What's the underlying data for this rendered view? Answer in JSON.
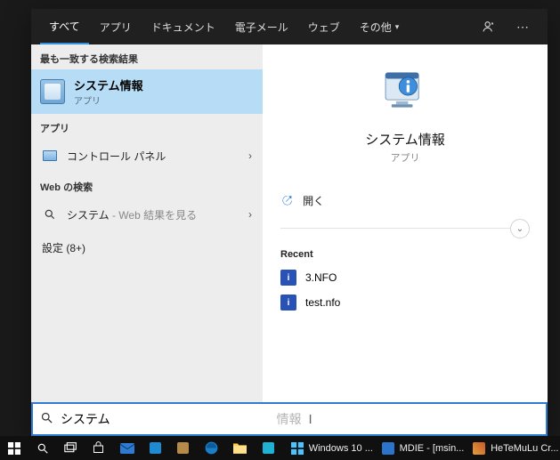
{
  "tabs": {
    "all": "すべて",
    "apps": "アプリ",
    "documents": "ドキュメント",
    "email": "電子メール",
    "web": "ウェブ",
    "more": "その他"
  },
  "left": {
    "best_header": "最も一致する検索結果",
    "best_title": "システム情報",
    "best_sub": "アプリ",
    "apps_header": "アプリ",
    "control_panel": "コントロール パネル",
    "web_header": "Web の検索",
    "web_system": "システム",
    "web_suffix": " - Web 結果を見る",
    "settings": "設定 (8+)"
  },
  "right": {
    "title": "システム情報",
    "sub": "アプリ",
    "open": "開く",
    "recent_header": "Recent",
    "recent": [
      "3.NFO",
      "test.nfo"
    ]
  },
  "search": {
    "value": "システム",
    "placeholder": "情報"
  },
  "taskbar": {
    "items": [
      {
        "label": "Windows 10 ..."
      },
      {
        "label": "MDIE - [msin..."
      },
      {
        "label": "HeTeMuLu Cr..."
      }
    ]
  }
}
